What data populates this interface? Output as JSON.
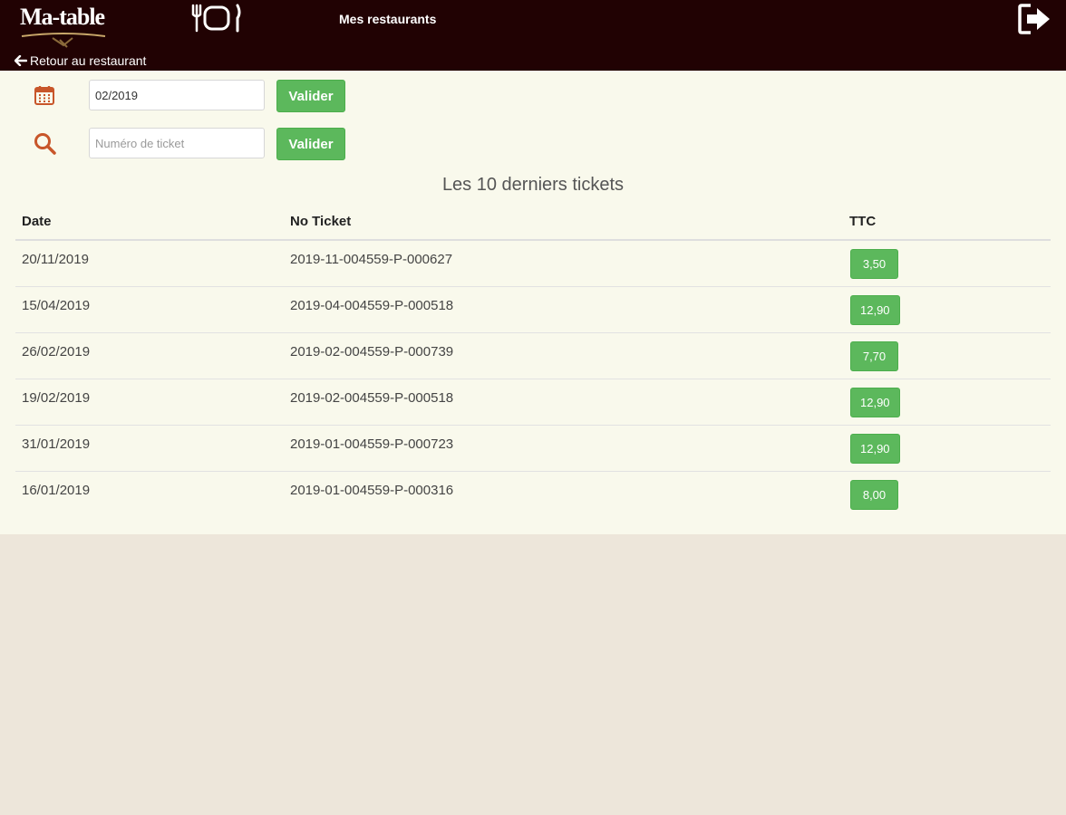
{
  "header": {
    "logo_text": "Ma-table",
    "nav_link": "Mes restaurants",
    "back_label": "Retour au restaurant"
  },
  "icons": {
    "logo": "ma-table-logo",
    "cutlery": "plate-cutlery-icon",
    "logout": "sign-out-icon",
    "back": "arrow-left-icon",
    "calendar": "calendar-icon",
    "search": "search-icon"
  },
  "filters": {
    "month_value": "02/2019",
    "month_button": "Valider",
    "ticket_placeholder": "Numéro de ticket",
    "ticket_button": "Valider"
  },
  "tickets": {
    "title": "Les 10 derniers tickets",
    "columns": [
      "Date",
      "No Ticket",
      "TTC"
    ],
    "rows": [
      {
        "date": "20/11/2019",
        "number": "2019-11-004559-P-000627",
        "ttc": "3,50"
      },
      {
        "date": "15/04/2019",
        "number": "2019-04-004559-P-000518",
        "ttc": "12,90"
      },
      {
        "date": "26/02/2019",
        "number": "2019-02-004559-P-000739",
        "ttc": "7,70"
      },
      {
        "date": "19/02/2019",
        "number": "2019-02-004559-P-000518",
        "ttc": "12,90"
      },
      {
        "date": "31/01/2019",
        "number": "2019-01-004559-P-000723",
        "ttc": "12,90"
      },
      {
        "date": "16/01/2019",
        "number": "2019-01-004559-P-000316",
        "ttc": "8,00"
      }
    ]
  },
  "colors": {
    "header_bg": "#210203",
    "content_bg": "#f9f9ec",
    "page_bg": "#ede6da",
    "button_green": "#5cb85c",
    "icon_orange": "#c8562a"
  }
}
